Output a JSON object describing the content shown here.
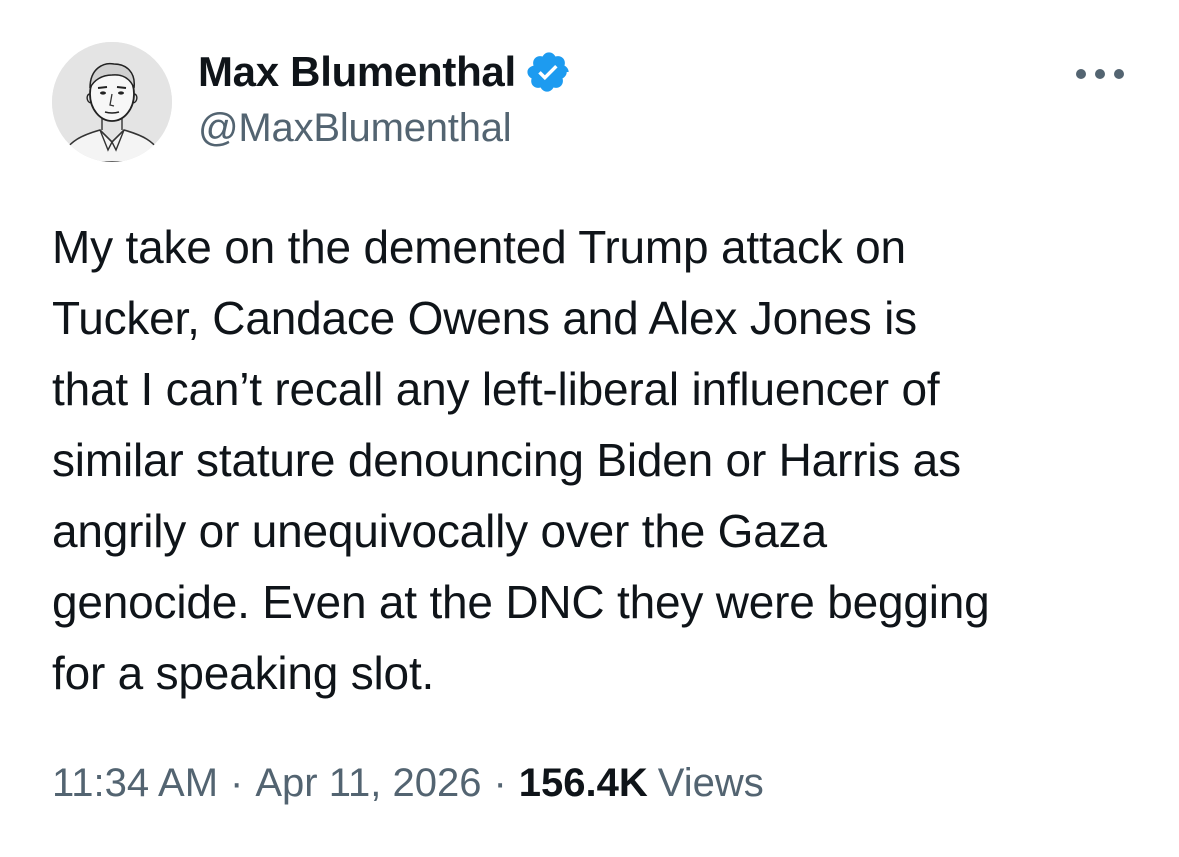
{
  "author": {
    "display_name": "Max Blumenthal",
    "handle": "@MaxBlumenthal",
    "verified": true,
    "avatar_icon": "sketched-portrait-avatar",
    "verified_icon": "verified-badge-icon",
    "verified_color": "#1d9bf0"
  },
  "more_icon": "more-options-icon",
  "tweet": {
    "lines": [
      "My take on the demented Trump attack on",
      "Tucker, Candace Owens and Alex Jones is",
      "that I can’t recall any left-liberal influencer of",
      "similar stature denouncing Biden or Harris as",
      "angrily or unequivocally over the Gaza",
      "genocide. Even at the DNC they were begging",
      "for a speaking slot."
    ]
  },
  "meta": {
    "time": "11:34 AM",
    "separator": "·",
    "date": "Apr 11, 2026",
    "views_count": "156.4K",
    "views_label": "Views"
  },
  "colors": {
    "text_primary": "#0f1419",
    "text_secondary": "#536471",
    "background": "#ffffff"
  }
}
